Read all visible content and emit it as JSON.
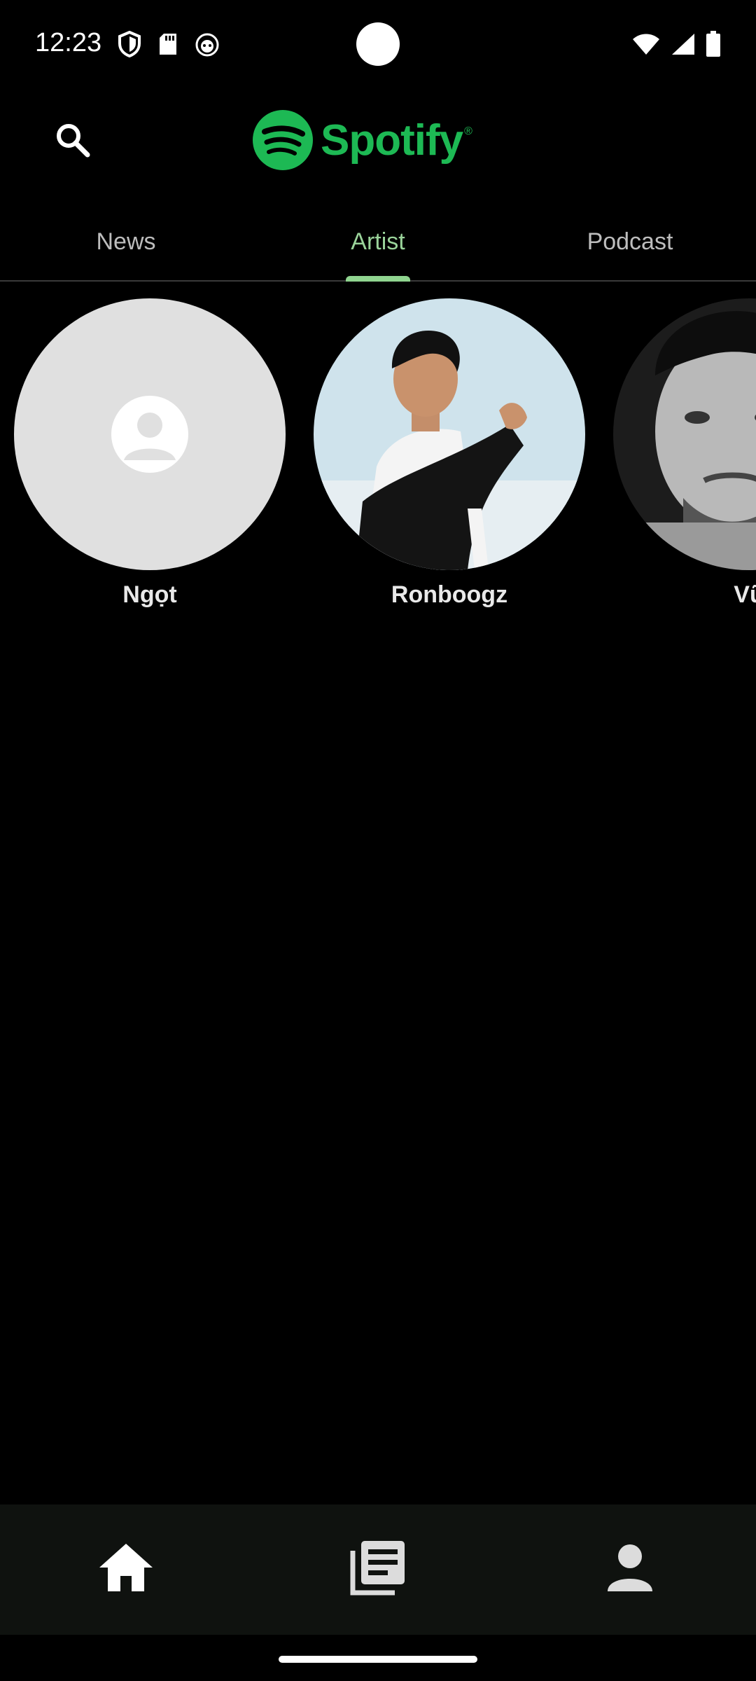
{
  "status": {
    "time": "12:23",
    "icons_left": [
      "shield-icon",
      "sd-card-icon",
      "cat-icon"
    ],
    "icons_right": [
      "wifi-icon",
      "signal-icon",
      "battery-icon"
    ]
  },
  "header": {
    "brand": "Spotify",
    "brand_mark": "®",
    "search_icon": "search-icon"
  },
  "tabs": [
    {
      "label": "News",
      "active": false
    },
    {
      "label": "Artist",
      "active": true
    },
    {
      "label": "Podcast",
      "active": false
    }
  ],
  "artists": [
    {
      "name": "Ngọt",
      "avatar": "placeholder"
    },
    {
      "name": "Ronboogz",
      "avatar": "photo"
    },
    {
      "name": "Vũ",
      "avatar": "photo"
    }
  ],
  "bottom_nav": [
    {
      "icon": "home-icon",
      "active": true
    },
    {
      "icon": "news-icon",
      "active": false
    },
    {
      "icon": "profile-icon",
      "active": false
    }
  ],
  "colors": {
    "brand": "#1DB954",
    "active_tab": "#9ad39a",
    "background": "#000000",
    "nav_background": "#0f120f"
  }
}
